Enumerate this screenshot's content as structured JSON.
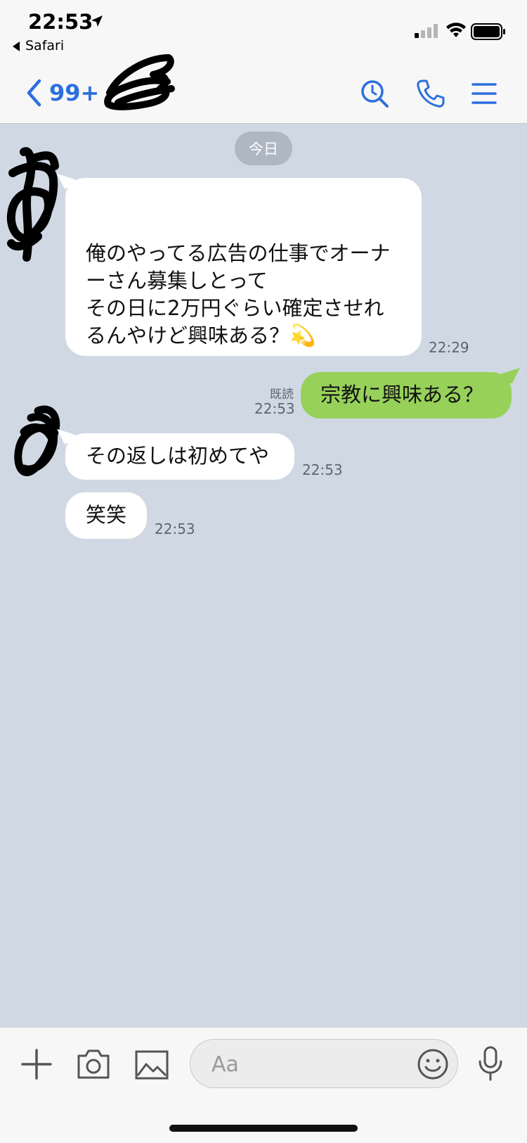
{
  "status_bar": {
    "time": "22:53",
    "back_app": "Safari"
  },
  "header": {
    "back_count": "99+"
  },
  "chat": {
    "date_label": "今日",
    "messages": [
      {
        "side": "left",
        "text": "俺のやってる広告の仕事でオーナ\nーさん募集しとって\nその日に2万円ぐらい確定させれ\nるんやけど興味ある？",
        "emoji": "💫",
        "time": "22:29"
      },
      {
        "side": "right",
        "text": "宗教に興味ある？",
        "read": "既読",
        "time": "22:53"
      },
      {
        "side": "left",
        "text": "その返しは初めてや",
        "time": "22:53"
      },
      {
        "side": "left",
        "text": "笑笑",
        "time": "22:53"
      }
    ]
  },
  "input": {
    "placeholder": "Aa"
  },
  "colors": {
    "accent": "#2c6fde",
    "chat_bg": "#d0d9e3",
    "sent_bubble": "#97d15a"
  }
}
